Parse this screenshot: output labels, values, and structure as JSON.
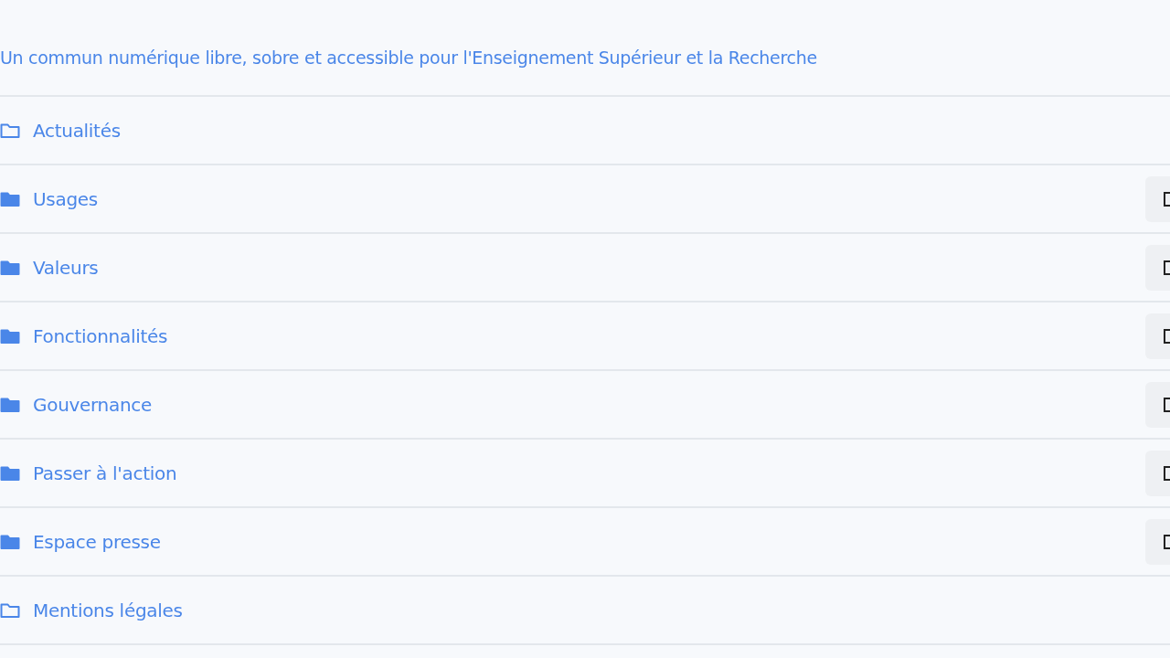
{
  "tagline": "Un commun numérique libre, sobre et accessible pour l'Enseignement Supérieur et la Recherche",
  "menu": [
    {
      "label": "Actualités",
      "kind": "empty"
    },
    {
      "label": "Usages",
      "kind": "parent"
    },
    {
      "label": "Valeurs",
      "kind": "parent"
    },
    {
      "label": "Fonctionnalités",
      "kind": "parent"
    },
    {
      "label": "Gouvernance",
      "kind": "parent"
    },
    {
      "label": "Passer à l'action",
      "kind": "parent"
    },
    {
      "label": "Espace presse",
      "kind": "parent"
    },
    {
      "label": "Mentions légales",
      "kind": "empty"
    }
  ]
}
